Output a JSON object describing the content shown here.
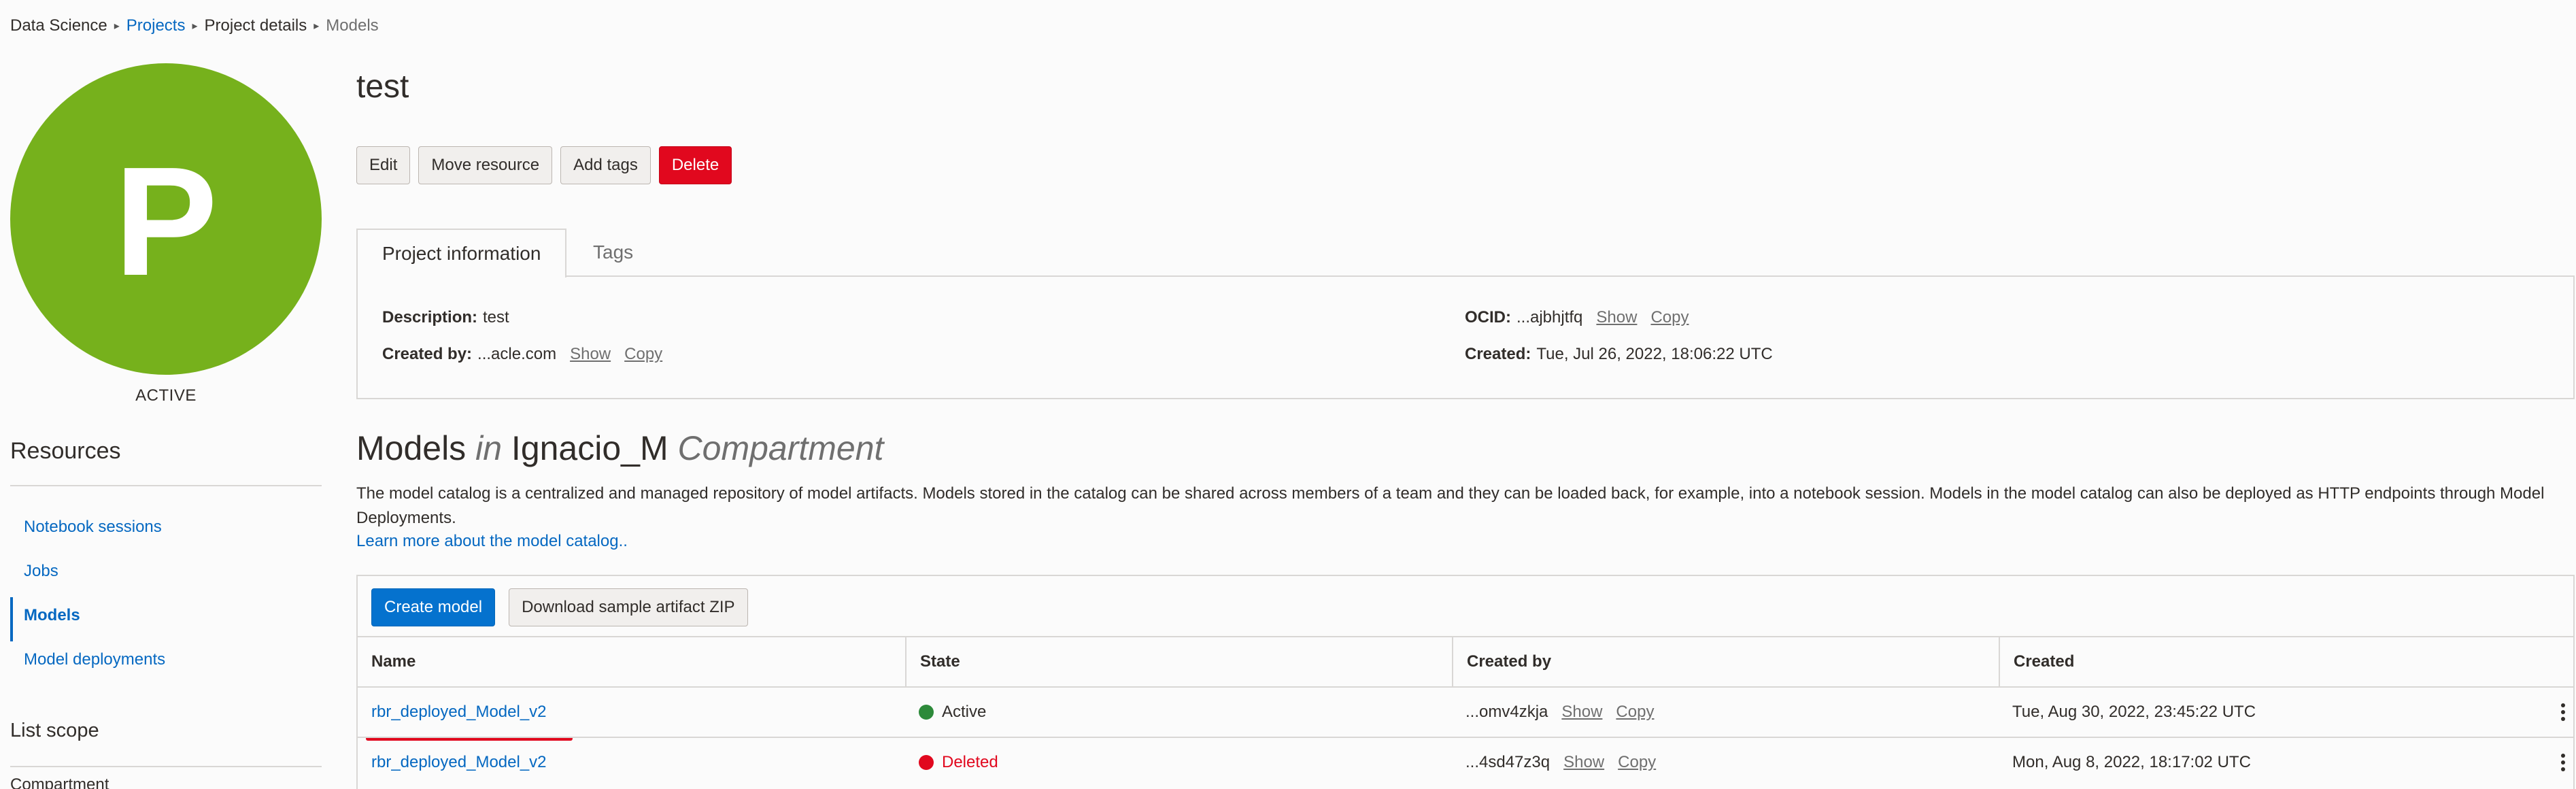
{
  "breadcrumb": {
    "items": [
      "Data Science",
      "Projects",
      "Project details",
      "Models"
    ]
  },
  "project": {
    "avatar_letter": "P",
    "status": "ACTIVE",
    "title": "test",
    "avatar_color": "#76b11c"
  },
  "actions": {
    "edit": "Edit",
    "move_resource": "Move resource",
    "add_tags": "Add tags",
    "delete": "Delete"
  },
  "tabs": {
    "project_information": "Project information",
    "tags": "Tags"
  },
  "info": {
    "description_label": "Description:",
    "description_value": "test",
    "created_by_label": "Created by:",
    "created_by_value": "...acle.com",
    "ocid_label": "OCID:",
    "ocid_value": "...ajbhjtfq",
    "created_label": "Created:",
    "created_value": "Tue, Jul 26, 2022, 18:06:22 UTC",
    "show": "Show",
    "copy": "Copy"
  },
  "sidebar": {
    "resources_title": "Resources",
    "items": [
      {
        "label": "Notebook sessions",
        "active": false
      },
      {
        "label": "Jobs",
        "active": false
      },
      {
        "label": "Models",
        "active": true
      },
      {
        "label": "Model deployments",
        "active": false
      }
    ],
    "list_scope": "List scope",
    "compartment_label": "Compartment"
  },
  "models": {
    "heading_main": "Models",
    "heading_in": "in",
    "heading_compartment_name": "Ignacio_M",
    "heading_compartment": "Compartment",
    "description": "The model catalog is a centralized and managed repository of model artifacts. Models stored in the catalog can be shared across members of a team and they can be loaded back, for example, into a notebook session. Models in the model catalog can also be deployed as HTTP endpoints through Model Deployments.",
    "learn_more": "Learn more about the model catalog..",
    "create_button": "Create model",
    "download_button": "Download sample artifact ZIP",
    "columns": [
      "Name",
      "State",
      "Created by",
      "Created"
    ],
    "rows": [
      {
        "name": "rbr_deployed_Model_v2",
        "state": "Active",
        "created_by": "...omv4zkja",
        "show": "Show",
        "copy": "Copy",
        "created": "Tue, Aug 30, 2022, 23:45:22 UTC"
      },
      {
        "name": "rbr_deployed_Model_v2",
        "state": "Deleted",
        "created_by": "...4sd47z3q",
        "show": "Show",
        "copy": "Copy",
        "created": "Mon, Aug 8, 2022, 18:17:02 UTC"
      }
    ]
  },
  "colors": {
    "link": "#0568c1",
    "danger": "#e1081e",
    "primary": "#0572ce",
    "active_state": "#2d8a3a"
  }
}
